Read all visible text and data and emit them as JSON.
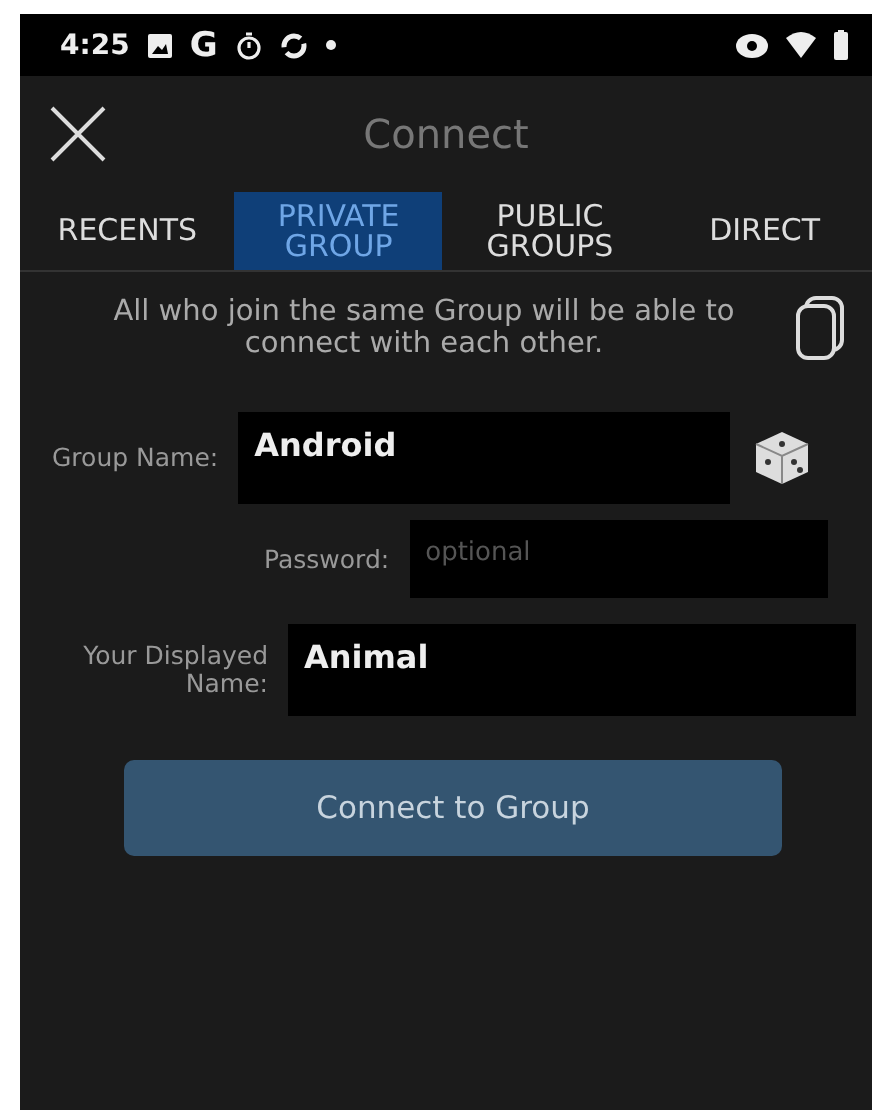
{
  "status_bar": {
    "time": "4:25",
    "app_letter": "G"
  },
  "header": {
    "title": "Connect"
  },
  "tabs": [
    {
      "label": "RECENTS",
      "selected": false
    },
    {
      "label": "PRIVATE GROUP",
      "selected": true
    },
    {
      "label": "PUBLIC GROUPS",
      "selected": false
    },
    {
      "label": "DIRECT",
      "selected": false
    }
  ],
  "description": "All who join the same Group will be able to connect with each other.",
  "form": {
    "group_name": {
      "label": "Group Name:",
      "value": "Android"
    },
    "password": {
      "label": "Password:",
      "placeholder": "optional"
    },
    "display_name": {
      "label": "Your Displayed Name:",
      "value": "Animal"
    }
  },
  "button": "Connect to Group"
}
